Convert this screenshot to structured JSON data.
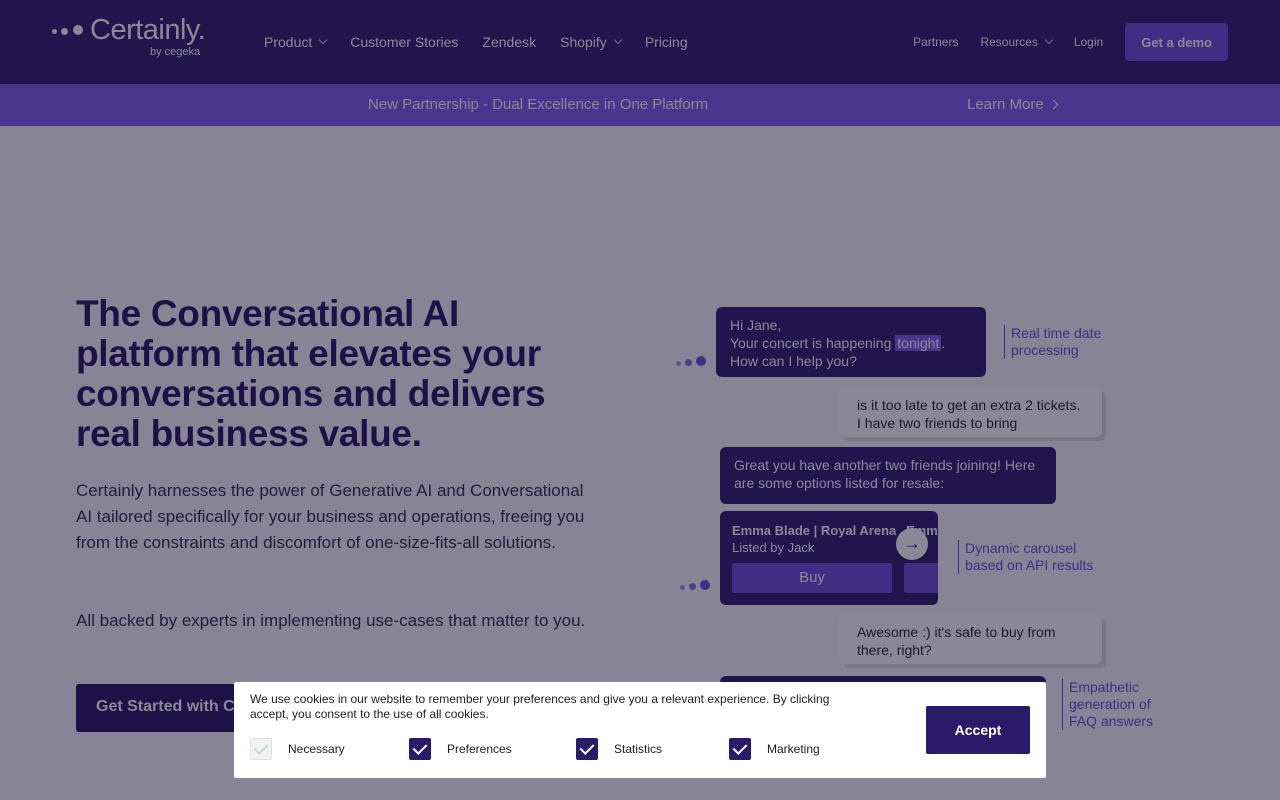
{
  "nav": {
    "logo": "Certainly.",
    "logo_by": "by cegeka",
    "links": [
      "Product",
      "Customer Stories",
      "Zendesk",
      "Shopify",
      "Pricing"
    ],
    "right_links": [
      "Partners",
      "Resources",
      "Login"
    ],
    "demo_label": "Get a demo"
  },
  "banner": {
    "text": "New Partnership - Dual Excellence in One Platform",
    "link": "Learn More"
  },
  "hero": {
    "headline": "The Conversational AI platform that elevates your conversations and delivers real business value.",
    "para1": "Certainly harnesses the power of Generative AI and Conversational AI tailored specifically for your business and operations, freeing you from the constraints and discomfort of one-size-fits-all solutions.",
    "para2": "All backed by experts in implementing use-cases that matter to you.",
    "cta": "Get Started with Ce"
  },
  "chat": {
    "bot1_line1": "Hi Jane,",
    "bot1_line2a": "Your concert is happening ",
    "bot1_hl": "tonight",
    "bot1_line2b": ".",
    "bot1_line3": "How can I help you?",
    "note1": "Real time date processing",
    "user1": "is it too late to get an extra 2 tickets. I have two friends to bring",
    "bot2": "Great you have another two friends joining! Here are some options listed for resale:",
    "card_title": "Emma Blade | Royal Arena",
    "card_sub": "Listed by Jack",
    "card2_title": "Emma",
    "buy": "Buy",
    "arrow": "→",
    "note2": "Dynamic carousel based on API results",
    "user2": "Awesome :) it's safe to buy from there, right?",
    "note3": "Empathetic generation of FAQ answers"
  },
  "cookie": {
    "text": "We use cookies in our website to remember your preferences and give you a relevant experience. By clicking accept, you consent to the use of all cookies.",
    "options": [
      {
        "label": "Necessary",
        "checked": true
      },
      {
        "label": "Preferences",
        "checked": true
      },
      {
        "label": "Statistics",
        "checked": true
      },
      {
        "label": "Marketing",
        "checked": true
      }
    ],
    "accept": "Accept"
  }
}
